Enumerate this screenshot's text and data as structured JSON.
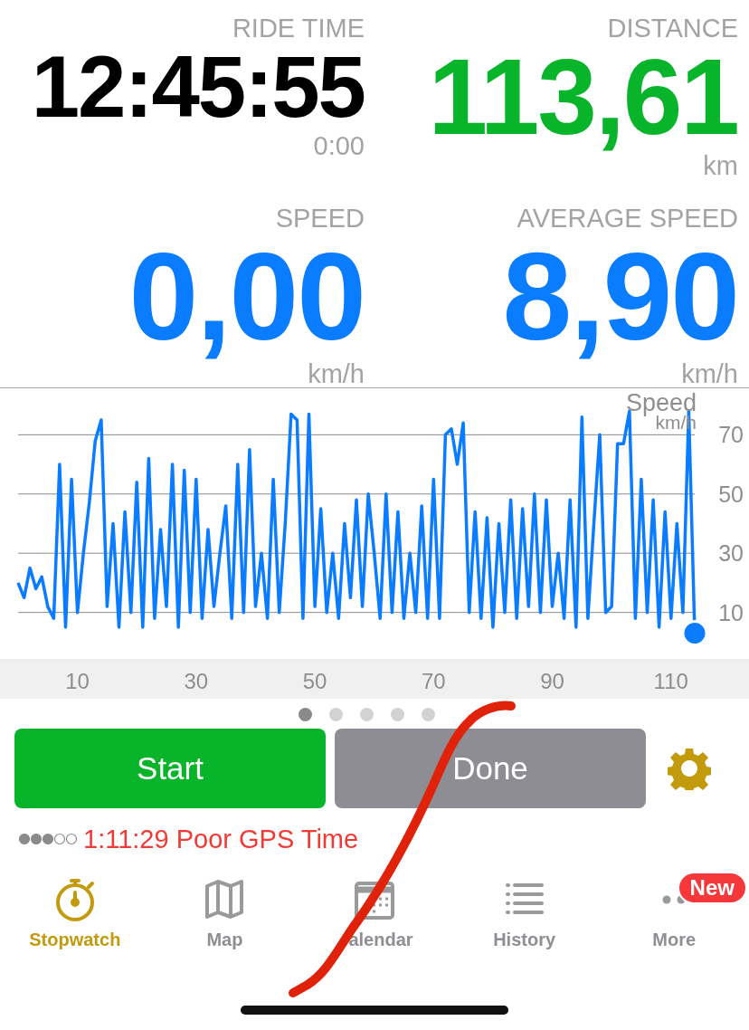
{
  "stats": [
    {
      "label": "RIDE TIME",
      "value": "12:45:55",
      "color": "#000000",
      "sub": "0:00"
    },
    {
      "label": "DISTANCE",
      "value": "113,61",
      "color": "#08b52a",
      "unit": "km"
    },
    {
      "label": "SPEED",
      "value": "0,00",
      "color": "#0a7cff",
      "unit": "km/h"
    },
    {
      "label": "AVERAGE SPEED",
      "value": "8,90",
      "color": "#0a7cff",
      "unit": "km/h"
    }
  ],
  "chart": {
    "chart_data": {
      "type": "line",
      "ylabel": "km/h",
      "grid": true,
      "xlim": [
        0,
        114
      ],
      "ylim": [
        -6,
        86
      ],
      "xticks": [
        10,
        30,
        50,
        70,
        90,
        110
      ],
      "yticks": [
        10,
        30,
        50,
        70
      ],
      "x": [
        0,
        1,
        2,
        3,
        4,
        5,
        6,
        7,
        8,
        9,
        10,
        11,
        12,
        13,
        14,
        15,
        16,
        17,
        18,
        19,
        20,
        21,
        22,
        23,
        24,
        25,
        26,
        27,
        28,
        29,
        30,
        31,
        32,
        33,
        34,
        35,
        36,
        37,
        38,
        39,
        40,
        41,
        42,
        43,
        44,
        45,
        46,
        47,
        48,
        49,
        50,
        51,
        52,
        53,
        54,
        55,
        56,
        57,
        58,
        59,
        60,
        61,
        62,
        63,
        64,
        65,
        66,
        67,
        68,
        69,
        70,
        71,
        72,
        73,
        74,
        75,
        76,
        77,
        78,
        79,
        80,
        81,
        82,
        83,
        84,
        85,
        86,
        87,
        88,
        89,
        90,
        91,
        92,
        93,
        94,
        95,
        96,
        97,
        98,
        99,
        100,
        101,
        102,
        103,
        104,
        105,
        106,
        107,
        108,
        109,
        110,
        111,
        112,
        113,
        114
      ],
      "series": [
        {
          "name": "Speed",
          "color": "#0a7cff",
          "values": [
            20,
            15,
            25,
            18,
            22,
            12,
            8,
            60,
            5,
            55,
            10,
            30,
            47,
            68,
            75,
            12,
            40,
            5,
            44,
            10,
            54,
            5,
            62,
            8,
            38,
            12,
            60,
            5,
            58,
            10,
            55,
            8,
            38,
            12,
            30,
            46,
            8,
            60,
            10,
            65,
            12,
            30,
            8,
            55,
            10,
            40,
            77,
            75,
            8,
            77,
            12,
            45,
            10,
            30,
            8,
            40,
            15,
            48,
            12,
            50,
            30,
            8,
            50,
            10,
            44,
            8,
            30,
            10,
            46,
            8,
            55,
            8,
            70,
            72,
            60,
            74,
            10,
            44,
            8,
            42,
            5,
            40,
            10,
            48,
            8,
            45,
            12,
            50,
            10,
            48,
            12,
            30,
            8,
            48,
            5,
            76,
            8,
            40,
            70,
            10,
            12,
            67,
            67,
            78,
            8,
            55,
            10,
            48,
            5,
            44,
            8,
            40,
            10,
            78,
            3
          ]
        }
      ]
    }
  },
  "pager": [
    {
      "selected": true
    },
    {
      "selected": false
    },
    {
      "selected": false
    },
    {
      "selected": false
    },
    {
      "selected": false
    }
  ],
  "buttons": [
    {
      "label": "Start",
      "kind": "primary"
    },
    {
      "label": "Done",
      "kind": "secondary"
    }
  ],
  "gps_status": "1:11:29 Poor GPS Time",
  "tabs": [
    {
      "label": "Stopwatch",
      "kind": "stopwatch",
      "selected": true
    },
    {
      "label": "Map",
      "kind": "map",
      "selected": false
    },
    {
      "label": "alendar",
      "kind": "calendar",
      "selected": false
    },
    {
      "label": "History",
      "kind": "list",
      "selected": false
    },
    {
      "label": "More",
      "kind": "more",
      "selected": false,
      "badge": "New"
    }
  ]
}
